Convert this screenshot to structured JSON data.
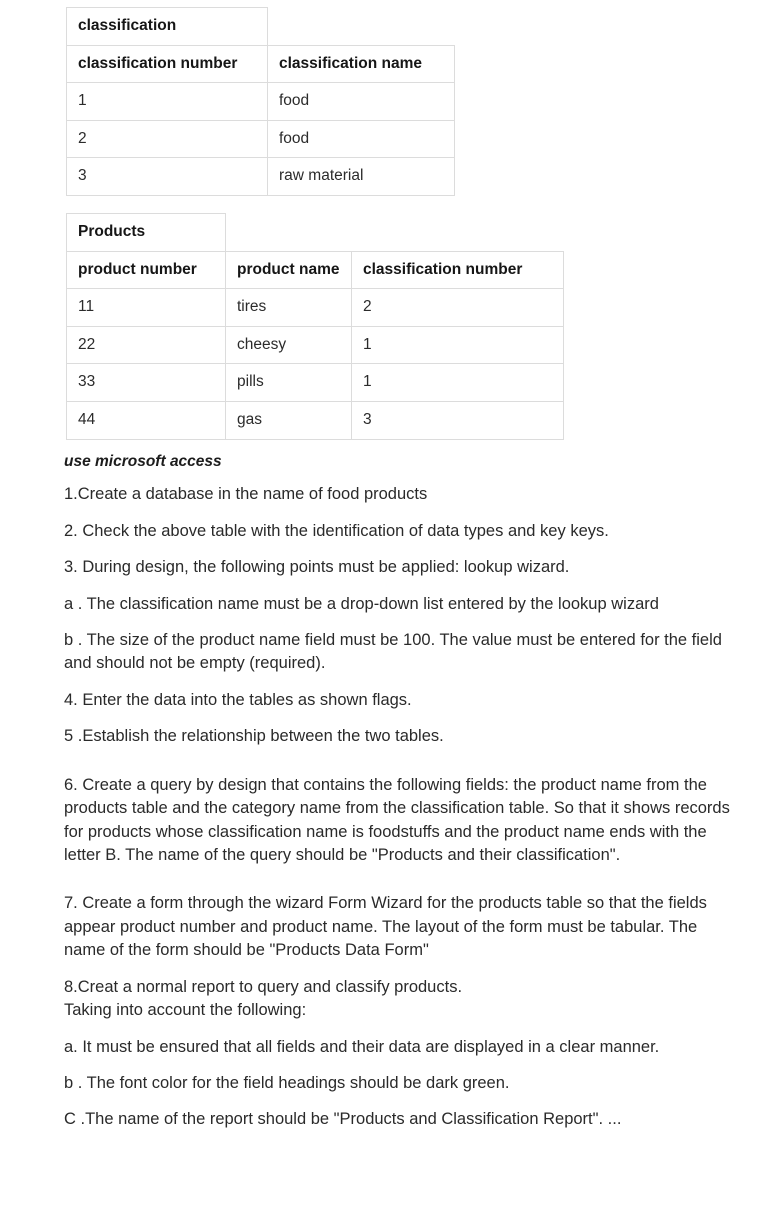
{
  "document": {
    "classification_table": {
      "caption": "classification",
      "headers": [
        "classification number",
        "classification  name"
      ],
      "rows": [
        [
          "1",
          "food"
        ],
        [
          "2",
          "food"
        ],
        [
          "3",
          "raw material"
        ]
      ]
    },
    "products_table": {
      "caption": "Products",
      "headers": [
        "product number",
        "product name",
        "classification number"
      ],
      "rows": [
        [
          "11",
          "tires",
          "2"
        ],
        [
          "22",
          "cheesy",
          "1"
        ],
        [
          "33",
          "pills",
          "1"
        ],
        [
          "44",
          "gas",
          "3"
        ]
      ]
    },
    "instruction_heading": "use microsoft access",
    "paragraphs": [
      "1.Create a database in the name of food products",
      "2. Check the above table with the identification of data types and key keys.",
      "3. During design, the following points must be applied: lookup wizard.",
      "a . The classification name must be a drop-down list entered by the lookup wizard",
      "b . The size of the product name field must be 100. The value must be entered for the field and should not be empty (required).",
      "4. Enter the data into the tables as shown flags.",
      "5 .Establish the relationship between the two tables.",
      "6. Create a query by design that contains the following fields: the product name from the products table and the category name from the classification table. So that it shows records for products whose classification name is foodstuffs and the product name ends with the letter B. The name of the query should be \"Products and their classification\".",
      "7. Create a form through the wizard Form Wizard for the products table so that the fields appear product number and product name. The layout of the form must be tabular. The name of the form should be \"Products Data Form\"",
      "8.Creat a normal report to query and classify products.\nTaking into account the following:",
      "a. It must be ensured that all fields and their data are displayed in a clear manner.",
      "b . The font color for the field headings should be dark green.",
      "C .The name of the report should be \"Products and Classification Report\". ..."
    ]
  },
  "colors": {
    "background": "#ffffff",
    "text": "#2a2a2a",
    "heading": "#161616",
    "table_border": "#dcdcdc"
  }
}
